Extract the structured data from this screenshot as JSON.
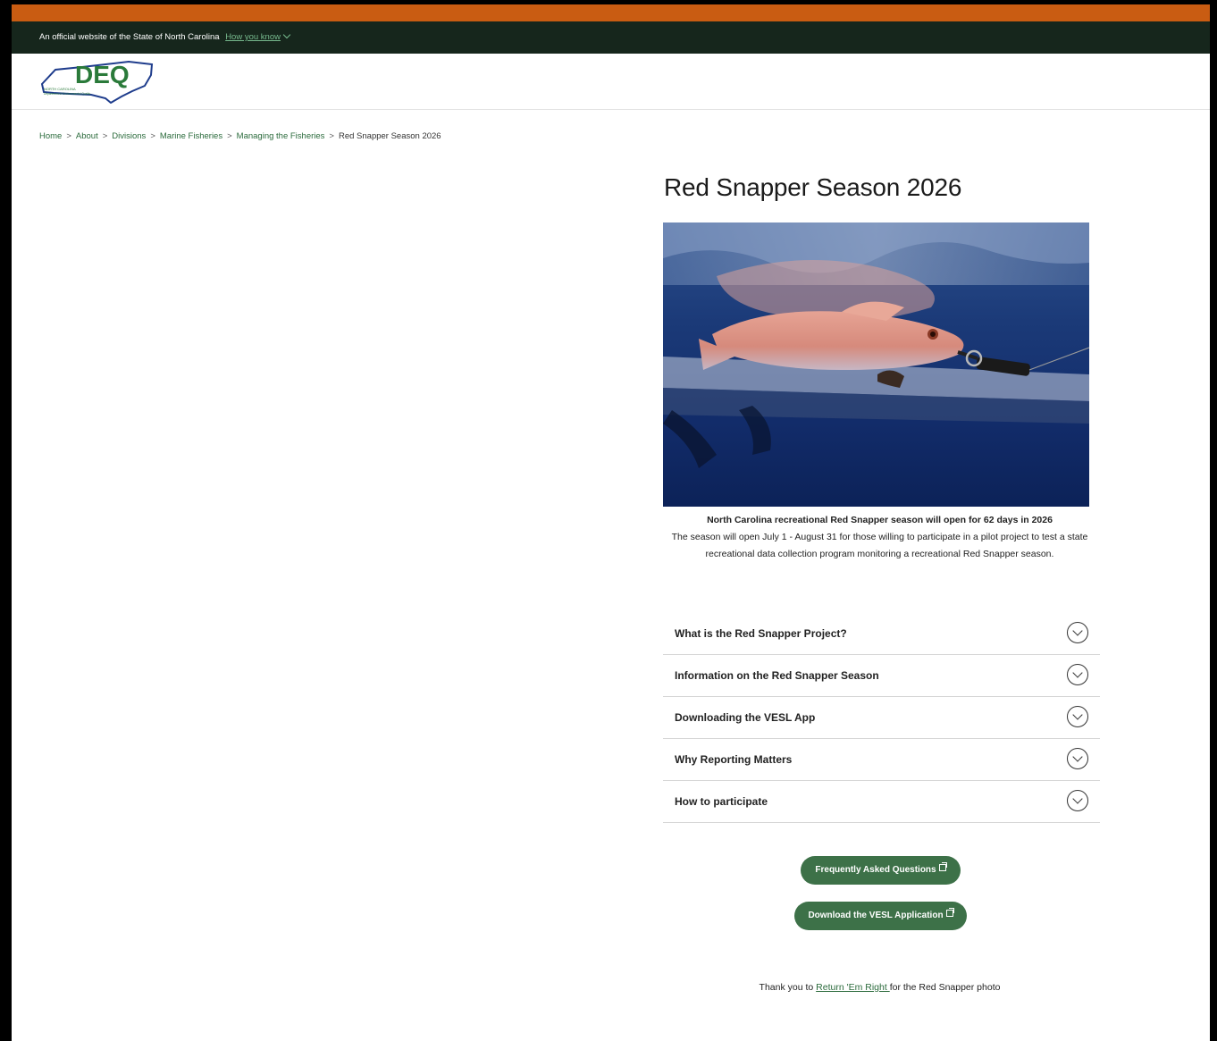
{
  "banner": {
    "official_text": "An official website of the State of North Carolina",
    "how_you_know": "How you know"
  },
  "logo": {
    "text": "DEQ",
    "subtext_1": "NORTH CAROLINA",
    "subtext_2": "Department of Environmental Quality"
  },
  "breadcrumb": {
    "items": [
      "Home",
      "About",
      "Divisions",
      "Marine Fisheries",
      "Managing the Fisheries"
    ],
    "current": "Red Snapper Season 2026",
    "separator": ">"
  },
  "main": {
    "title": "Red Snapper Season 2026",
    "caption_title": "North Carolina recreational Red Snapper season will open for 62 days in 2026",
    "caption_body": "The season will open July 1 - August 31 for those willing to participate in a pilot project to test a state recreational data collection program monitoring a recreational Red Snapper season."
  },
  "accordion": {
    "items": [
      "What is the Red Snapper Project?",
      "Information on the Red Snapper Season",
      "Downloading the VESL App",
      "Why Reporting Matters",
      "How to participate"
    ]
  },
  "buttons": {
    "faq": "Frequently Asked Questions",
    "download": "Download the VESL Application"
  },
  "credit": {
    "prefix": "Thank you to ",
    "link": "Return 'Em Right ",
    "suffix": "for the Red Snapper photo"
  },
  "colors": {
    "accent_orange": "#c95c12",
    "banner_dark": "#16261c",
    "brand_green": "#3d7148",
    "link_green": "#2b6b3c"
  }
}
